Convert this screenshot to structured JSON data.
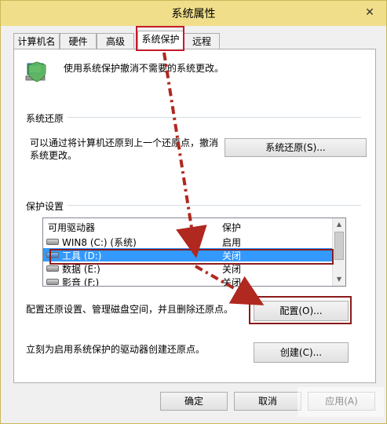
{
  "window": {
    "title": "系统属性",
    "close_icon": "✕"
  },
  "tabs": [
    {
      "label": "计算机名"
    },
    {
      "label": "硬件"
    },
    {
      "label": "高级"
    },
    {
      "label": "系统保护"
    },
    {
      "label": "远程"
    }
  ],
  "active_tab": 3,
  "header": {
    "description": "使用系统保护撤消不需要的系统更改。"
  },
  "restore": {
    "section_title": "系统还原",
    "description_line1": "可以通过将计算机还原到上一个还原点，撤消",
    "description_line2": "系统更改。",
    "button_label": "系统还原(S)..."
  },
  "protection": {
    "section_title": "保护设置",
    "columns": [
      "可用驱动器",
      "保护"
    ],
    "drives": [
      {
        "name": "WIN8 (C:) (系统)",
        "status": "启用",
        "selected": false
      },
      {
        "name": "工具 (D:)",
        "status": "关闭",
        "selected": true
      },
      {
        "name": "数据 (E:)",
        "status": "关闭",
        "selected": false
      },
      {
        "name": "影音 (F:)",
        "status": "关闭",
        "selected": false
      }
    ],
    "configure_text": "配置还原设置、管理磁盘空间，并且删除还原点。",
    "configure_button": "配置(O)...",
    "create_text": "立刻为启用系统保护的驱动器创建还原点。",
    "create_button": "创建(C)..."
  },
  "footer": {
    "ok_button": "确定",
    "cancel_button": "取消",
    "apply_button": "应用(A)"
  },
  "colors": {
    "annotation": "#b0281f",
    "selection": "#3399ff",
    "highlight_box": "#8b1a1a"
  }
}
